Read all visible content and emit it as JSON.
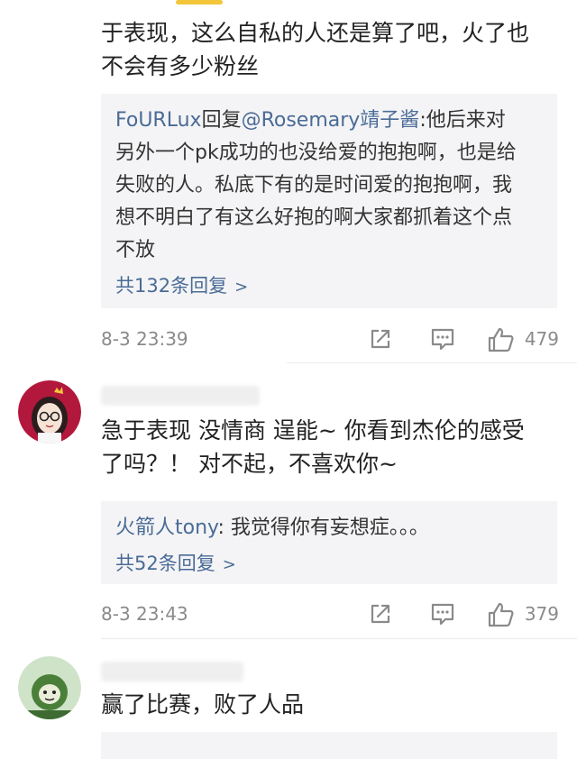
{
  "comment1": {
    "text_line1": "于表现，这么自私的人还是算了吧，火了也",
    "text_line2": "不会有多少粉丝",
    "reply": {
      "author": "FoURLux",
      "verb": "回复",
      "target": "@Rosemary靖子酱",
      "text_line1": ":他后来对",
      "text_line2": "另外一个pk成功的也没给爱的抱抱啊，也是给",
      "text_line3": "失败的人。私底下有的是时间爱的抱抱啊，我",
      "text_line4": "想不明白了有这么好抱的啊大家都抓着这个点",
      "text_line5": "不放"
    },
    "more_replies": "共132条回复",
    "timestamp": "8-3 23:39",
    "likes": "479"
  },
  "comment2": {
    "text_line1": "急于表现 没情商 逞能~ 你看到杰伦的感受",
    "text_line2": "了吗？！ 对不起，不喜欢你~",
    "reply": {
      "author": "火箭人tony",
      "text": ": 我觉得你有妄想症。。。"
    },
    "more_replies": "共52条回复",
    "timestamp": "8-3 23:43",
    "likes": "379"
  },
  "comment3": {
    "text_line1": "赢了比赛，败了人品"
  },
  "icons": {
    "share": "share-icon",
    "comment": "comment-icon",
    "like": "thumbs-up-icon",
    "chevron": "chevron-right-icon"
  },
  "colors": {
    "link": "#4a6b96",
    "meta": "#8a8a8a",
    "reply_bg": "#f4f4f6",
    "accent_bar": "#f3c63a"
  }
}
